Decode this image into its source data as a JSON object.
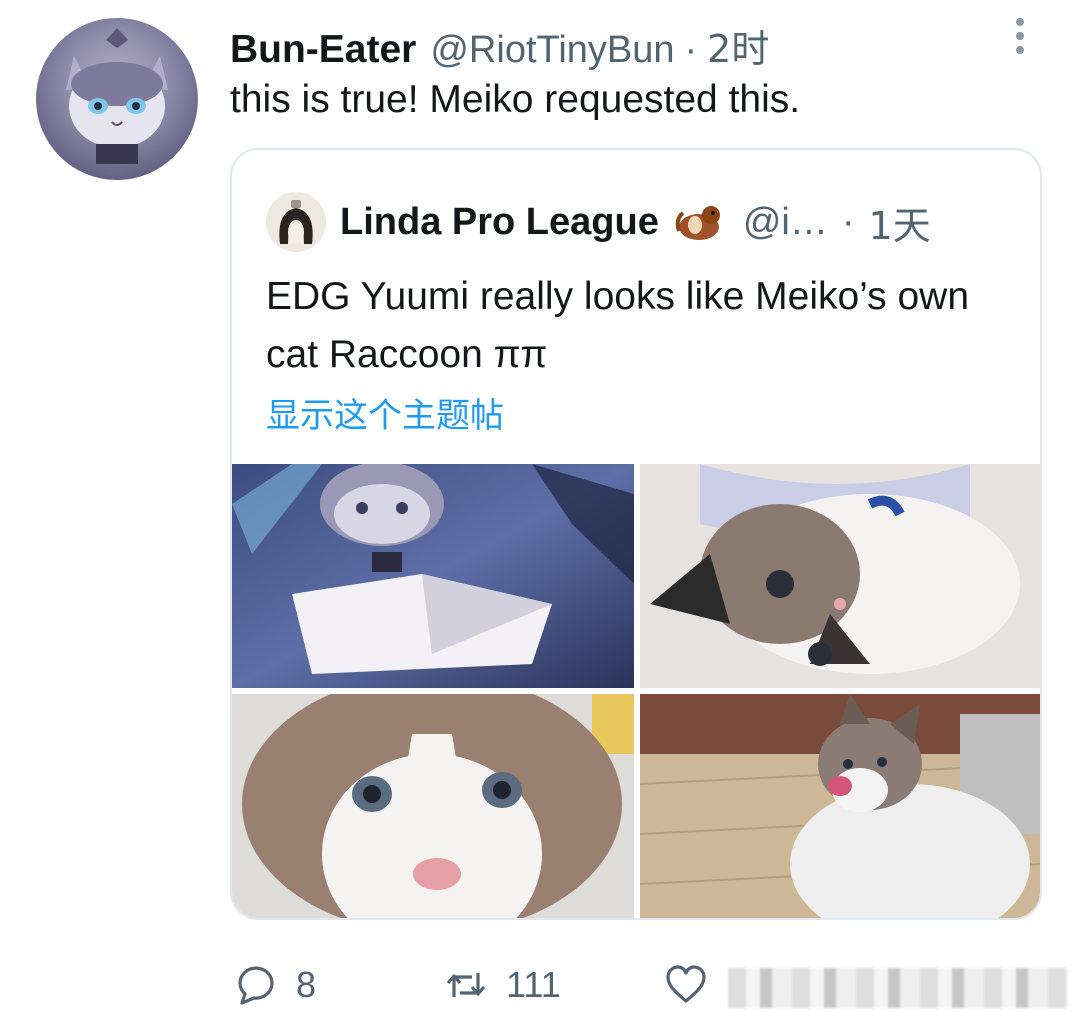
{
  "tweet": {
    "display_name": "Bun-Eater",
    "handle": "@RiotTinyBun",
    "separator": "·",
    "time": "2时",
    "text": "this is true! Meiko requested this.",
    "avatar_icon": "yuumi-cat-avatar",
    "more_icon": "more-vertical-icon"
  },
  "quote": {
    "display_name": "Linda Pro League",
    "emoji_icon": "otter-emoji",
    "handle": "@i…",
    "separator": "·",
    "time": "1天",
    "text": "EDG Yuumi really looks like Meiko’s own cat Raccoon ππ",
    "show_thread": "显示这个主题帖",
    "images": [
      {
        "name": "yuumi-reading-book-image"
      },
      {
        "name": "ragdoll-cat-lying-image"
      },
      {
        "name": "ragdoll-cat-closeup-image"
      },
      {
        "name": "ragdoll-cat-licking-image"
      }
    ]
  },
  "actions": {
    "reply_count": "8",
    "retweet_count": "111",
    "like_count": ""
  },
  "colors": {
    "link": "#1d9bf0",
    "secondary_text": "#536471",
    "border": "#e1e8ed"
  }
}
